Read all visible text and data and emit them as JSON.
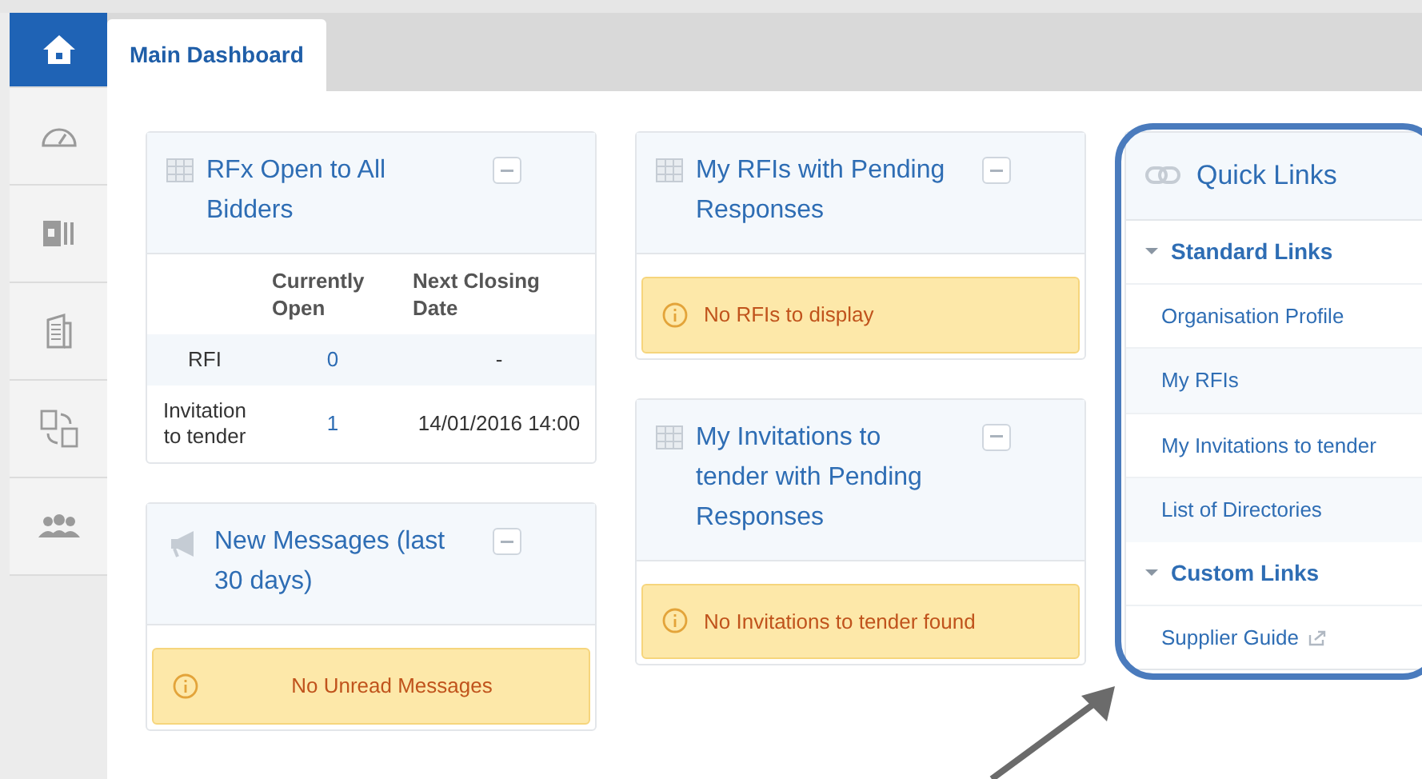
{
  "sidebar": {
    "items": [
      {
        "kind": "home",
        "selected": true
      },
      {
        "kind": "gauge",
        "selected": false
      },
      {
        "kind": "presentation",
        "selected": false
      },
      {
        "kind": "building",
        "selected": false
      },
      {
        "kind": "exchange",
        "selected": false
      },
      {
        "kind": "people",
        "selected": false
      }
    ]
  },
  "tabs": [
    {
      "label": "Main Dashboard",
      "selected": true
    }
  ],
  "columns": [
    {
      "panels": [
        {
          "kind": "table",
          "title": "RFx Open to All Bidders",
          "table": {
            "columns": [
              "Currently Open",
              "Next Closing Date"
            ],
            "rows": [
              {
                "label": "RFI",
                "open": "0",
                "closing": "-"
              },
              {
                "label": "Invitation to tender",
                "open": "1",
                "closing": "14/01/2016 14:00"
              }
            ]
          }
        },
        {
          "kind": "messages",
          "title": "New Messages (last 30 days)",
          "alert": "No Unread Messages"
        }
      ]
    },
    {
      "panels": [
        {
          "kind": "alert",
          "title": "My RFIs with Pending Responses",
          "alert": "No RFIs to display"
        },
        {
          "kind": "alert",
          "title": "My Invitations to tender with Pending Responses",
          "alert": "No Invitations to tender found"
        }
      ]
    }
  ],
  "quick_links": {
    "title": "Quick Links",
    "groups": [
      {
        "title": "Standard Links",
        "expanded": true,
        "links": [
          {
            "label": "Organisation Profile",
            "external": false
          },
          {
            "label": "My RFIs",
            "external": false
          },
          {
            "label": "My Invitations to tender",
            "external": false
          },
          {
            "label": "List of Directories",
            "external": false
          }
        ]
      },
      {
        "title": "Custom Links",
        "expanded": true,
        "links": [
          {
            "label": "Supplier Guide",
            "external": true
          }
        ]
      }
    ]
  },
  "annotations": {
    "outline": true,
    "arrow": true
  }
}
